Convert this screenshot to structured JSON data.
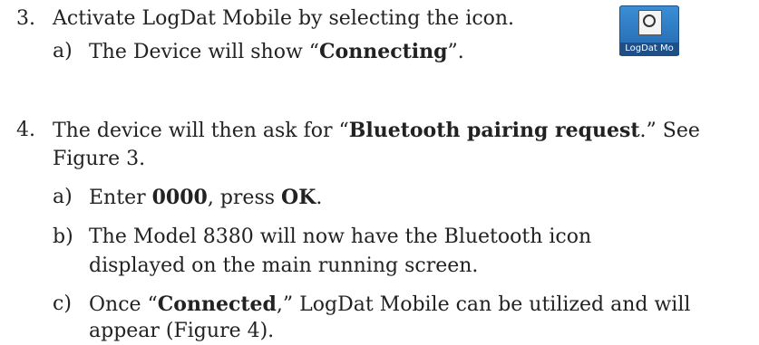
{
  "step3": {
    "num": "3.",
    "text": "Activate LogDat Mobile by selecting the icon.",
    "sub_a": {
      "letter": "a)",
      "pre": "The Device will show “",
      "bold": "Connecting",
      "post": "”."
    }
  },
  "app_icon": {
    "icon": "logdat-mobile-app-icon",
    "label": "LogDat Mo"
  },
  "step4": {
    "num": "4.",
    "line1_pre": "The device will then ask for “",
    "line1_bold": "Bluetooth pairing request",
    "line1_post": ".” See",
    "line2": "Figure 3.",
    "sub_a": {
      "letter": "a)",
      "pre": "Enter ",
      "bold1": "0000",
      "mid": ", press ",
      "bold2": "OK",
      "post": "."
    },
    "sub_b": {
      "letter": "b)",
      "line1": "The Model 8380 will now have the Bluetooth icon",
      "line2": "displayed on the main running screen."
    },
    "sub_c": {
      "letter": "c)",
      "line1_pre": "Once “",
      "line1_bold": "Connected",
      "line1_post": ",” LogDat Mobile can be utilized and will",
      "line2": "appear (Figure 4)."
    }
  }
}
